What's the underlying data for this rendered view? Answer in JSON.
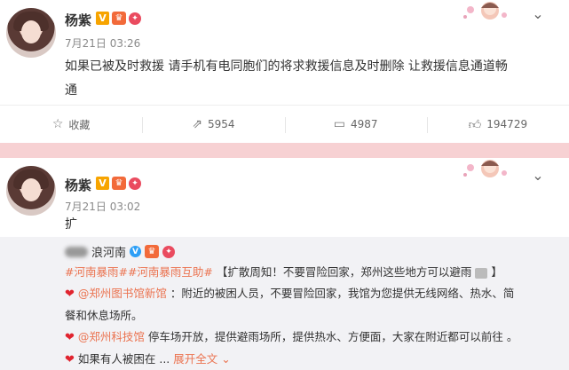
{
  "posts": [
    {
      "author": "杨紫",
      "time": "7月21日 03:26",
      "text_line1": "如果已被及时救援 请手机有电同胞们的将求救援信息及时删除 让救援信息通道畅",
      "text_line2": "通",
      "actions": {
        "favorite_label": "收藏",
        "repost_count": "5954",
        "comment_count": "4987",
        "like_count": "194729"
      }
    },
    {
      "author": "杨紫",
      "time": "7月21日 03:02",
      "text": "扩",
      "repost": {
        "author_suffix": "浪河南",
        "line1_tags": "#河南暴雨##河南暴雨互助#",
        "line1_rest": "【扩散周知！不要冒险回家，郑州这些地方可以避雨",
        "line1_end": "】",
        "line2_mention": "@郑州图书馆新馆",
        "line2_rest": "：附近的被困人员，不要冒险回家，我馆为您提供无线网络、热水、简",
        "line3": "餐和休息场所。",
        "line4_mention": "@郑州科技馆",
        "line4_rest": " 停车场开放，提供避雨场所，提供热水、方便面，大家在附近都可以前往 。",
        "line5_text": "如果有人被困在 ... ",
        "line5_more": "展开全文"
      }
    }
  ],
  "icons": {
    "favorite": "star-outline-icon",
    "repost": "share-arrow-icon",
    "comment": "comment-bubble-icon",
    "like": "thumbs-up-icon",
    "chevron": "chevron-down-icon",
    "heart": "heart-icon"
  },
  "colors": {
    "page_bg": "#f7d1d3",
    "link": "#eb7350",
    "heart": "#e0242f",
    "badge_v": "#f7a400",
    "repost_bg": "#f2f2f5"
  }
}
